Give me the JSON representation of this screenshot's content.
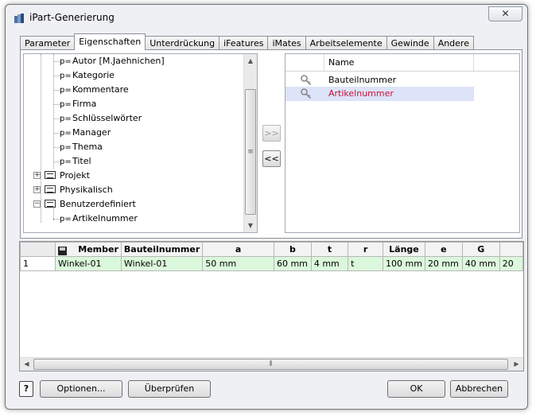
{
  "window": {
    "title": "iPart-Generierung",
    "close_glyph": "✕"
  },
  "tabs": [
    {
      "label": "Parameter",
      "active": false
    },
    {
      "label": "Eigenschaften",
      "active": true
    },
    {
      "label": "Unterdrückung",
      "active": false
    },
    {
      "label": "iFeatures",
      "active": false
    },
    {
      "label": "iMates",
      "active": false
    },
    {
      "label": "Arbeitselemente",
      "active": false
    },
    {
      "label": "Gewinde",
      "active": false
    },
    {
      "label": "Andere",
      "active": false
    }
  ],
  "tree": {
    "prop_prefix": "p=",
    "items": [
      {
        "label": "Autor [M.Jaehnichen]",
        "type": "prop"
      },
      {
        "label": "Kategorie",
        "type": "prop"
      },
      {
        "label": "Kommentare",
        "type": "prop"
      },
      {
        "label": "Firma",
        "type": "prop"
      },
      {
        "label": "Schlüsselwörter",
        "type": "prop"
      },
      {
        "label": "Manager",
        "type": "prop"
      },
      {
        "label": "Thema",
        "type": "prop"
      },
      {
        "label": "Titel",
        "type": "prop"
      },
      {
        "label": "Projekt",
        "type": "group",
        "expander": "+"
      },
      {
        "label": "Physikalisch",
        "type": "group",
        "expander": "+"
      },
      {
        "label": "Benutzerdefiniert",
        "type": "group",
        "expander": "−"
      },
      {
        "label": "Artikelnummer",
        "type": "prop"
      }
    ]
  },
  "move_buttons": {
    "add": ">>",
    "remove": "<<"
  },
  "selected_list": {
    "header_name": "Name",
    "items": [
      {
        "label": "Bauteilnummer",
        "selected": false
      },
      {
        "label": "Artikelnummer",
        "selected": true
      }
    ]
  },
  "grid": {
    "columns": [
      "Member",
      "Bauteilnummer",
      "a",
      "b",
      "t",
      "r",
      "Länge",
      "e",
      "G",
      ""
    ],
    "rows": [
      {
        "num": "1",
        "cells": [
          "Winkel-01",
          "Winkel-01",
          "50 mm",
          "60 mm",
          "4 mm",
          "t",
          "100 mm",
          "20 mm",
          "40 mm",
          "20"
        ]
      }
    ]
  },
  "buttons": {
    "help": "?",
    "options": "Optionen...",
    "check": "Überprüfen",
    "ok": "OK",
    "cancel": "Abbrechen"
  },
  "colors": {
    "selected_text": "#d0103a",
    "selected_row_bg": "#dde3f8",
    "grid_cell_bg": "#dcf8dc"
  }
}
